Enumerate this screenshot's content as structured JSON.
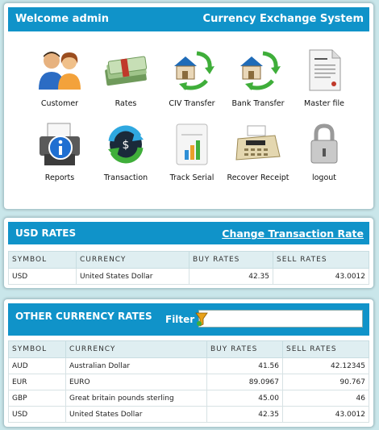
{
  "header": {
    "welcome": "Welcome admin",
    "system_title": "Currency Exchange System"
  },
  "menu": [
    {
      "label": "Customer",
      "icon": "customers-icon"
    },
    {
      "label": "Rates",
      "icon": "money-stack-icon"
    },
    {
      "label": "CIV Transfer",
      "icon": "house-transfer-icon"
    },
    {
      "label": "Bank Transfer",
      "icon": "bank-transfer-icon"
    },
    {
      "label": "Master file",
      "icon": "document-icon"
    },
    {
      "label": "Reports",
      "icon": "printer-info-icon"
    },
    {
      "label": "Transaction",
      "icon": "exchange-arrows-icon"
    },
    {
      "label": "Track Serial",
      "icon": "numbers-chart-icon"
    },
    {
      "label": "Recover Receipt",
      "icon": "cash-register-icon"
    },
    {
      "label": "logout",
      "icon": "padlock-icon"
    }
  ],
  "usd": {
    "title": "USD RATES",
    "change_link": "Change Transaction Rate",
    "columns": [
      "SYMBOL",
      "CURRENCY",
      "BUY RATES",
      "SELL RATES"
    ],
    "rows": [
      {
        "symbol": "USD",
        "currency": "United States Dollar",
        "buy": "42.35",
        "sell": "43.0012"
      }
    ]
  },
  "other": {
    "title": "OTHER CURRENCY RATES",
    "filter_label": "Filter",
    "filter_value": "",
    "columns": [
      "SYMBOL",
      "CURRENCY",
      "BUY RATES",
      "SELL RATES"
    ],
    "rows": [
      {
        "symbol": "AUD",
        "currency": "Australian Dollar",
        "buy": "41.56",
        "sell": "42.12345"
      },
      {
        "symbol": "EUR",
        "currency": "EURO",
        "buy": "89.0967",
        "sell": "90.767"
      },
      {
        "symbol": "GBP",
        "currency": "Great britain pounds sterling",
        "buy": "45.00",
        "sell": "46"
      },
      {
        "symbol": "USD",
        "currency": "United States Dollar",
        "buy": "42.35",
        "sell": "43.0012"
      }
    ]
  },
  "colors": {
    "header_bar": "#1093c9",
    "page_bg": "#c9e6ea",
    "table_header": "#dfeef1"
  }
}
